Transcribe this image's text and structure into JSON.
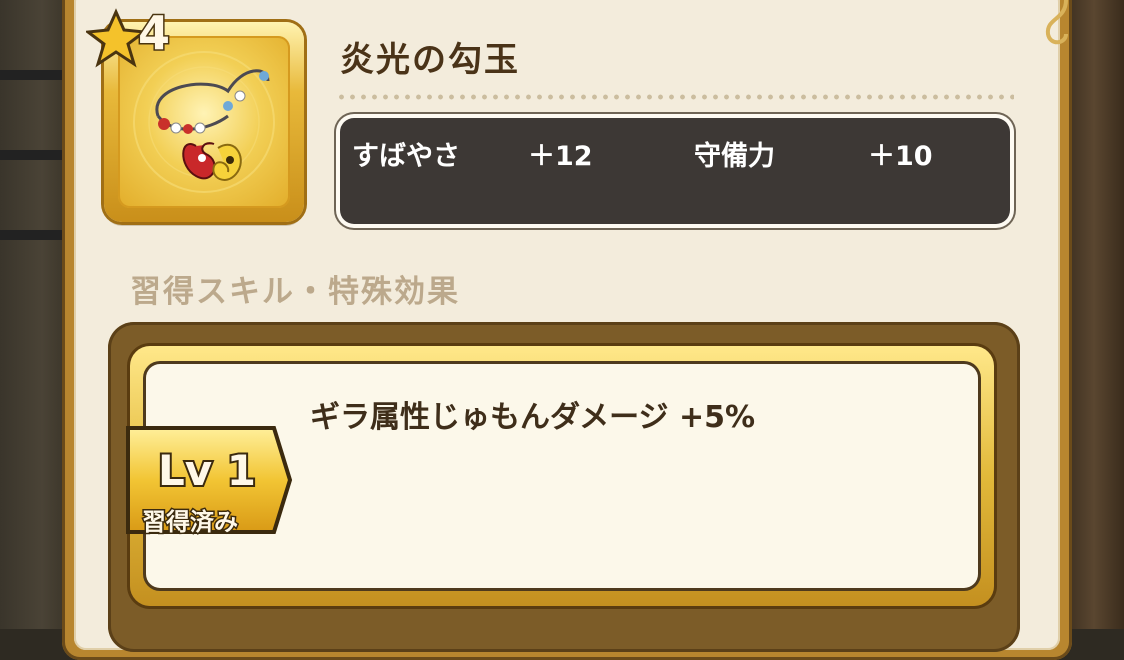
{
  "item": {
    "rarity": "4",
    "name": "炎光の勾玉",
    "icon": "magatama-necklace-icon"
  },
  "stats": [
    {
      "label": "すばやさ",
      "value": "＋12"
    },
    {
      "label": "守備力",
      "value": "＋10"
    }
  ],
  "section": {
    "title": "習得スキル・特殊効果"
  },
  "skill": {
    "level": "Lv 1",
    "status": "習得済み",
    "effect": "ギラ属性じゅもんダメージ +5%"
  },
  "colors": {
    "panel": "#f3ecdc",
    "gold": "#e2b93a",
    "stat_box": "#3d3835",
    "text_brown": "#4a3318"
  }
}
